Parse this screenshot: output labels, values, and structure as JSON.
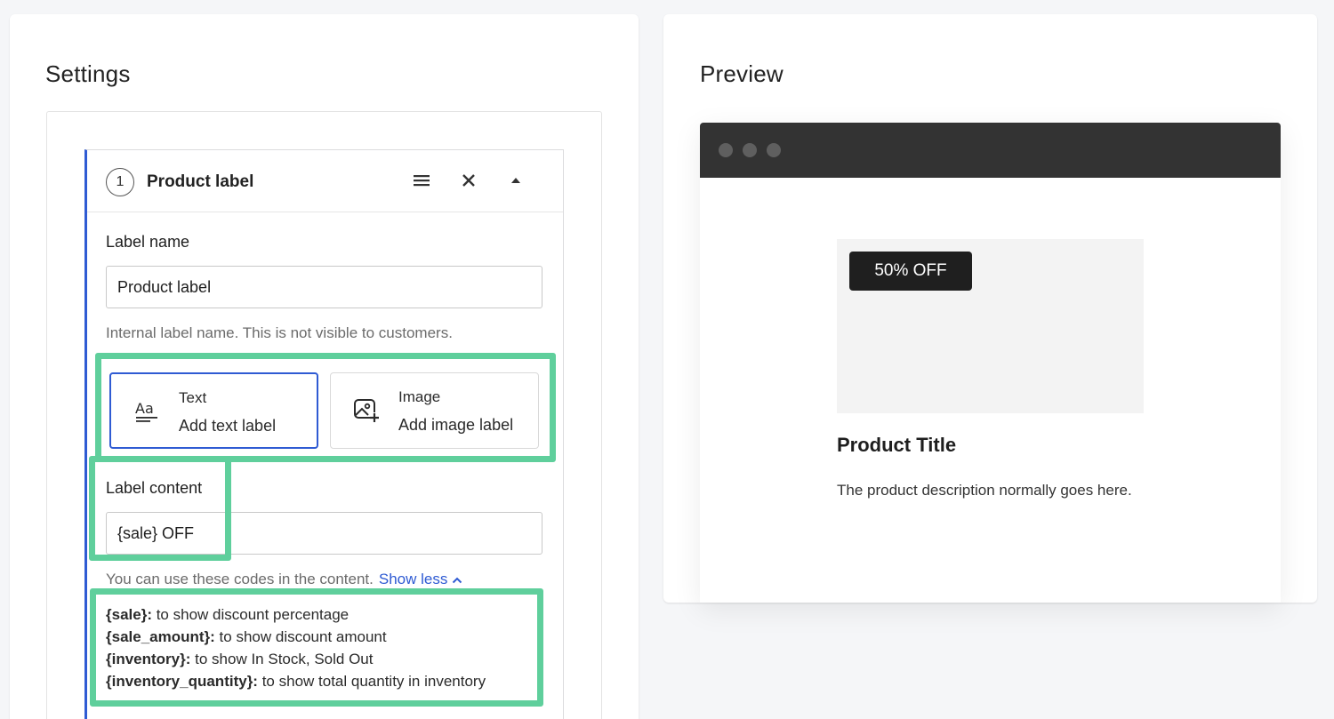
{
  "settings": {
    "title": "Settings",
    "panel": {
      "step_number": "1",
      "title": "Product label",
      "label_name": {
        "label": "Label name",
        "value": "Product label",
        "help": "Internal label name. This is not visible to customers."
      },
      "type_options": [
        {
          "title": "Text",
          "subtitle": "Add text label",
          "selected": true,
          "icon": "text-format-icon"
        },
        {
          "title": "Image",
          "subtitle": "Add image label",
          "selected": false,
          "icon": "add-image-icon"
        }
      ],
      "label_content": {
        "label": "Label content",
        "value": "{sale} OFF",
        "help": "You can use these codes in the content.",
        "toggle_label": "Show less"
      },
      "codes": [
        {
          "code": "{sale}:",
          "desc": " to show discount percentage"
        },
        {
          "code": "{sale_amount}:",
          "desc": " to show discount amount"
        },
        {
          "code": "{inventory}:",
          "desc": " to show In Stock, Sold Out"
        },
        {
          "code": "{inventory_quantity}:",
          "desc": " to show total quantity in inventory"
        }
      ]
    }
  },
  "preview": {
    "title": "Preview",
    "badge": "50% OFF",
    "product_title": "Product Title",
    "product_description": "The product description normally goes here."
  },
  "colors": {
    "accent": "#2f5bd3",
    "highlight": "#5fcf9c",
    "browser_bar": "#333333",
    "badge_bg": "#1f1f1f"
  }
}
